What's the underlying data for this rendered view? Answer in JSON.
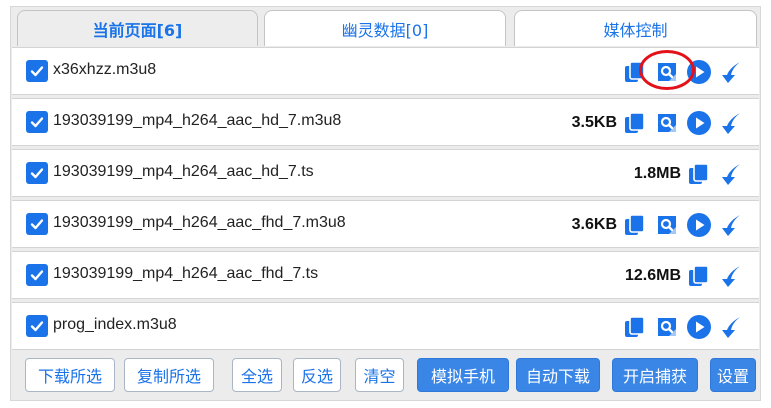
{
  "tabs": [
    {
      "label": "当前页面[6]",
      "active": true
    },
    {
      "label": "幽灵数据[0]",
      "active": false
    },
    {
      "label": "媒体控制",
      "active": false
    }
  ],
  "items": [
    {
      "name": "x36xhzz.m3u8",
      "size": "",
      "checked": true,
      "icons": [
        "copy-icon",
        "search-icon",
        "play-icon",
        "download-icon"
      ]
    },
    {
      "name": "193039199_mp4_h264_aac_hd_7.m3u8",
      "size": "3.5KB",
      "checked": true,
      "icons": [
        "copy-icon",
        "search-icon",
        "play-icon",
        "download-icon"
      ]
    },
    {
      "name": "193039199_mp4_h264_aac_hd_7.ts",
      "size": "1.8MB",
      "checked": true,
      "icons": [
        "copy-icon",
        "download-icon"
      ]
    },
    {
      "name": "193039199_mp4_h264_aac_fhd_7.m3u8",
      "size": "3.6KB",
      "checked": true,
      "icons": [
        "copy-icon",
        "search-icon",
        "play-icon",
        "download-icon"
      ]
    },
    {
      "name": "193039199_mp4_h264_aac_fhd_7.ts",
      "size": "12.6MB",
      "checked": true,
      "icons": [
        "copy-icon",
        "download-icon"
      ]
    },
    {
      "name": "prog_index.m3u8",
      "size": "",
      "checked": true,
      "icons": [
        "copy-icon",
        "search-icon",
        "play-icon",
        "download-icon"
      ]
    }
  ],
  "buttons": [
    {
      "label": "下载所选",
      "style": "outline"
    },
    {
      "label": "复制所选",
      "style": "outline"
    },
    {
      "label": "全选",
      "style": "outline"
    },
    {
      "label": "反选",
      "style": "outline"
    },
    {
      "label": "清空",
      "style": "outline"
    },
    {
      "label": "模拟手机",
      "style": "solid"
    },
    {
      "label": "自动下载",
      "style": "solid"
    },
    {
      "label": "开启捕获",
      "style": "solid"
    },
    {
      "label": "设置",
      "style": "solid"
    }
  ],
  "colors": {
    "accent": "#1a73e8",
    "highlight_ring": "#e3121a"
  }
}
